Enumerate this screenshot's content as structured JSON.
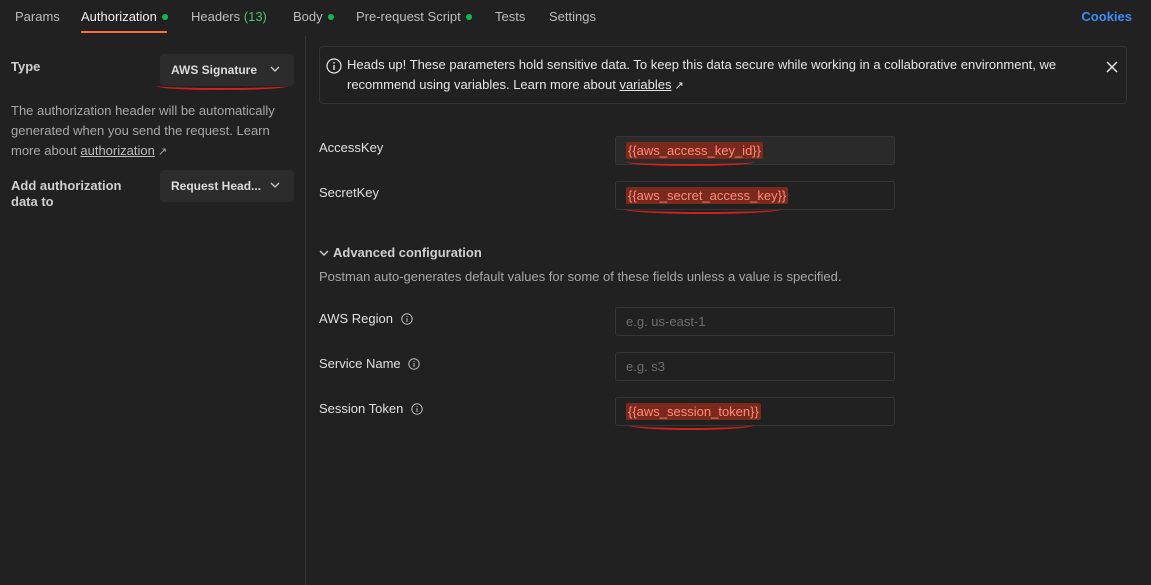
{
  "tabs": [
    {
      "label": "Params",
      "dot": false
    },
    {
      "label": "Authorization",
      "dot": true
    },
    {
      "label": "Headers",
      "count": "(13)"
    },
    {
      "label": "Body",
      "dot": true
    },
    {
      "label": "Pre-request Script",
      "dot": true
    },
    {
      "label": "Tests"
    },
    {
      "label": "Settings"
    }
  ],
  "cookies_label": "Cookies",
  "left": {
    "type_label": "Type",
    "type_value": "AWS Signature",
    "description": "The authorization header will be automatically generated when you send the request. Learn more about ",
    "description_link": "authorization",
    "add_auth_label": "Add authorization data to",
    "add_auth_value": "Request Head..."
  },
  "notice": {
    "text": "Heads up! These parameters hold sensitive data. To keep this data secure while working in a collaborative environment, we recommend using variables. Learn more about ",
    "link": "variables"
  },
  "fields": {
    "access_key": {
      "label": "AccessKey",
      "value": "{{aws_access_key_id}}"
    },
    "secret_key": {
      "label": "SecretKey",
      "value": "{{aws_secret_access_key}}"
    },
    "region": {
      "label": "AWS Region",
      "placeholder": "e.g. us-east-1"
    },
    "service": {
      "label": "Service Name",
      "placeholder": "e.g. s3"
    },
    "session": {
      "label": "Session Token",
      "value": "{{aws_session_token}}"
    }
  },
  "advanced": {
    "title": "Advanced configuration",
    "description": "Postman auto-generates default values for some of these fields unless a value is specified."
  },
  "colors": {
    "accent": "#ff6c37",
    "success": "#0cbb52",
    "link": "#3c8ef5",
    "annotation": "#d61f1f"
  }
}
